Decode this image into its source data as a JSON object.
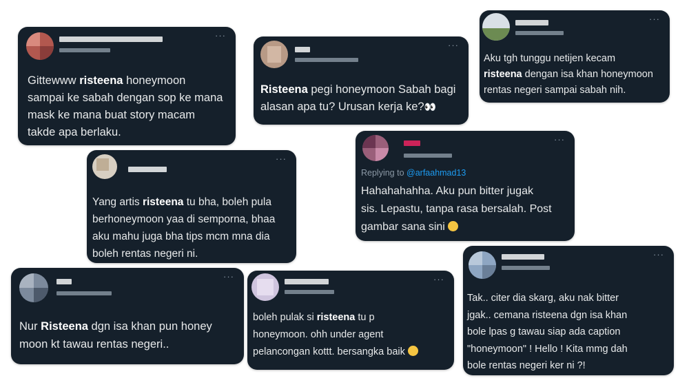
{
  "tweets": [
    {
      "more": "···",
      "pre": "Gittewww ",
      "kw": "risteena",
      "post": " honeymoon\nsampai ke sabah dengan sop ke mana\nmask ke mana buat story macam\ntakde apa berlaku."
    },
    {
      "more": "···",
      "pre": "",
      "kw": "Risteena",
      "post": " pegi honeymoon Sabah bagi\nalasan apa tu? Urusan kerja ke?"
    },
    {
      "more": "···",
      "pre": "Aku tgh tunggu netijen kecam\n",
      "kw": "risteena",
      "post": " dengan isa khan honeymoon\nrentas negeri sampai sabah nih."
    },
    {
      "more": "···",
      "pre": "Yang artis ",
      "kw": "risteena",
      "post": " tu bha, boleh pula\nberhoneymoon yaa di semporna, bhaa\naku mahu juga bha tips mcm mna dia\nboleh rentas negeri ni."
    },
    {
      "more": "···",
      "reply_prefix": "Replying to ",
      "reply_handle": "@arfaahmad13",
      "pre": "Hahahahahha. Aku pun bitter jugak\nsis. Lepastu, tanpa rasa bersalah. Post\ngambar sana sini ",
      "kw": "",
      "post": ""
    },
    {
      "more": "···",
      "pre": "Nur ",
      "kw": "Risteena",
      "post": " dgn isa khan pun honey\nmoon kt tawau rentas negeri.."
    },
    {
      "more": "···",
      "pre": "boleh pulak si ",
      "kw": "risteena",
      "post": " tu p\nhoneymoon. ohh under agent\npelancongan kottt. bersangka baik "
    },
    {
      "more": "···",
      "pre": "Tak.. citer dia skarg, aku nak bitter\njgak.. cemana risteena dgn isa khan\nbole lpas g tawau siap ada caption\n\"honeymoon\" ! Hello ! Kita mmg dah\nbole rentas negeri ker ni ?!",
      "kw": "",
      "post": ""
    }
  ],
  "colors": {
    "card_bg": "#15202b",
    "text": "#e7e9ea",
    "muted": "#8b98a5",
    "link": "#1d9bf0"
  },
  "icons": {
    "more": "more-options-icon",
    "eyes": "eyes-emoji-icon",
    "smirk": "smirk-emoji-icon",
    "thinking": "thinking-emoji-icon"
  }
}
